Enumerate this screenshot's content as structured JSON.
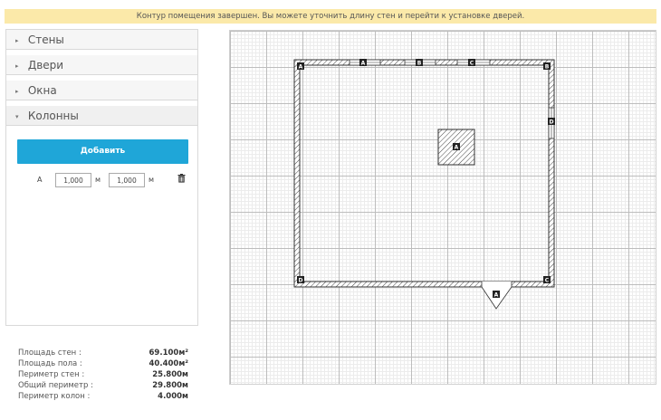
{
  "banner": {
    "message": "Контур помещения завершен. Вы можете уточнить длину стен и перейти к установке дверей."
  },
  "sidebar": {
    "sections": [
      {
        "label": "Стены",
        "expanded": false
      },
      {
        "label": "Двери",
        "expanded": false
      },
      {
        "label": "Окна",
        "expanded": false
      },
      {
        "label": "Колонны",
        "expanded": true
      }
    ],
    "columns_panel": {
      "add_button": "Добавить",
      "items": [
        {
          "name": "A",
          "width": "1,000",
          "width_unit": "м",
          "depth": "1,000",
          "depth_unit": "м",
          "delete_icon": "trash-icon"
        }
      ]
    }
  },
  "stats": [
    {
      "label": "Площадь стен :",
      "value": "69.100м²"
    },
    {
      "label": "Площадь пола :",
      "value": "40.400м²"
    },
    {
      "label": "Периметр стен :",
      "value": "25.800м"
    },
    {
      "label": "Общий периметр :",
      "value": "29.800м"
    },
    {
      "label": "Периметр колон :",
      "value": "4.000м"
    }
  ],
  "plan": {
    "corner_labels": [
      "A",
      "B",
      "C",
      "D"
    ],
    "window_labels": [
      "A",
      "B",
      "C",
      "D"
    ],
    "door_label": "A",
    "column_label": "A"
  },
  "colors": {
    "accent": "#1fa6d8",
    "banner": "#fbe9a9",
    "wall": "#333333",
    "tag": "#222222"
  }
}
